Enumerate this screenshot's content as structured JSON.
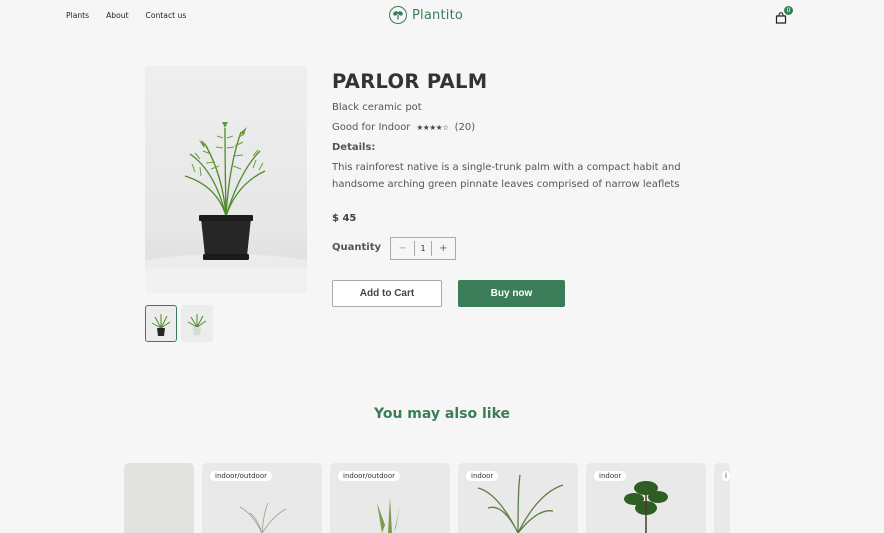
{
  "nav": {
    "links": [
      "Plants",
      "About",
      "Contact us"
    ],
    "brand": "Plantito",
    "cart_count": "0"
  },
  "product": {
    "title": "PARLOR PALM",
    "subtitle": "Black ceramic pot",
    "good_for": "Good for Indoor",
    "rating": 4,
    "rating_max": 5,
    "reviews": "(20)",
    "details_label": "Details:",
    "details": "This rainforest native is a single-trunk palm with a compact habit and handsome arching green pinnate leaves comprised of narrow leaflets",
    "price": "$ 45",
    "quantity_label": "Quantity",
    "quantity": "1",
    "minus": "−",
    "plus": "+",
    "add_to_cart": "Add to Cart",
    "buy_now": "Buy now"
  },
  "recommend": {
    "heading": "You may also like",
    "cards": [
      {
        "tag": ""
      },
      {
        "tag": "indoor/outdoor"
      },
      {
        "tag": "indoor/outdoor"
      },
      {
        "tag": "indoor"
      },
      {
        "tag": "indoor"
      },
      {
        "tag": "i"
      }
    ]
  },
  "colors": {
    "brand": "#3a7d58",
    "background": "#f6f6f6"
  }
}
